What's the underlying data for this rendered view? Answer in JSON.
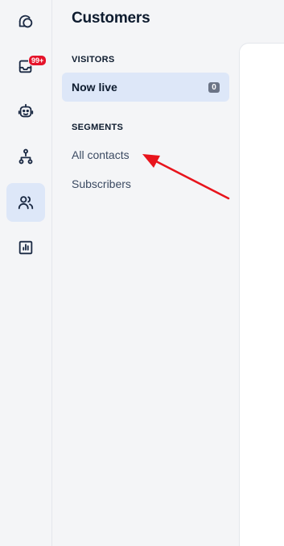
{
  "rail": {
    "items": [
      {
        "icon": "chat-bubbles-icon",
        "active": false
      },
      {
        "icon": "inbox-tray-icon",
        "active": false,
        "badge": "99+"
      },
      {
        "icon": "bot-icon",
        "active": false
      },
      {
        "icon": "flow-diagram-icon",
        "active": false
      },
      {
        "icon": "contacts-icon",
        "active": true
      },
      {
        "icon": "analytics-chart-icon",
        "active": false
      }
    ]
  },
  "panel": {
    "title": "Customers",
    "visitors": {
      "label": "VISITORS",
      "items": [
        {
          "label": "Now live",
          "count": "0",
          "active": true
        }
      ]
    },
    "segments": {
      "label": "SEGMENTS",
      "items": [
        {
          "label": "All contacts",
          "active": false
        },
        {
          "label": "Subscribers",
          "active": false
        }
      ]
    }
  },
  "colors": {
    "accent_bg": "#dde7f8",
    "badge_red": "#e5132a",
    "annotation_arrow": "#e8141c",
    "icon_stroke": "#1b2a44"
  }
}
